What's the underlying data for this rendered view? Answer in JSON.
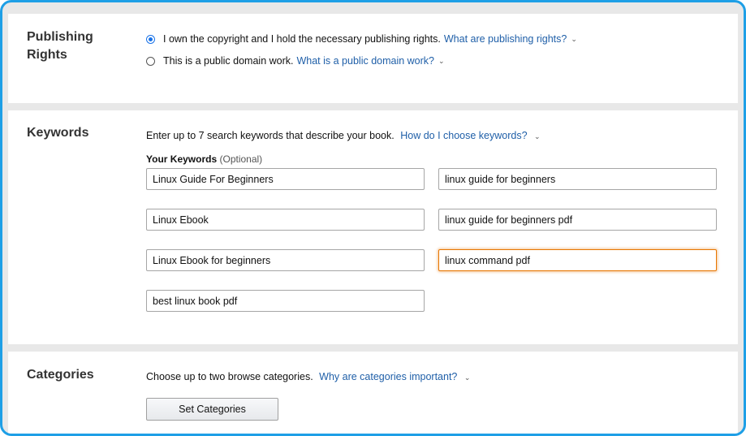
{
  "publishing_rights": {
    "title": "Publishing Rights",
    "option1_label": "I own the copyright and I hold the necessary publishing rights.",
    "option1_link": "What are publishing rights?",
    "option2_label": "This is a public domain work.",
    "option2_link": "What is a public domain work?",
    "selected": "option1"
  },
  "keywords": {
    "title": "Keywords",
    "intro": "Enter up to 7 search keywords that describe your book.",
    "intro_link": "How do I choose keywords?",
    "label": "Your Keywords",
    "label_optional": "(Optional)",
    "values": [
      "Linux Guide For Beginners",
      "linux guide for beginners",
      "Linux Ebook",
      "linux guide for beginners pdf",
      "Linux Ebook for beginners",
      "linux command pdf",
      "best linux book pdf"
    ],
    "focused_index": 5
  },
  "categories": {
    "title": "Categories",
    "intro": "Choose up to two browse categories.",
    "intro_link": "Why are categories important?",
    "button_label": "Set Categories"
  },
  "colors": {
    "frame_border": "#1e9fe6",
    "link": "#1f5fa8",
    "focus_border": "#e77600",
    "radio_selected": "#1a73e8"
  }
}
